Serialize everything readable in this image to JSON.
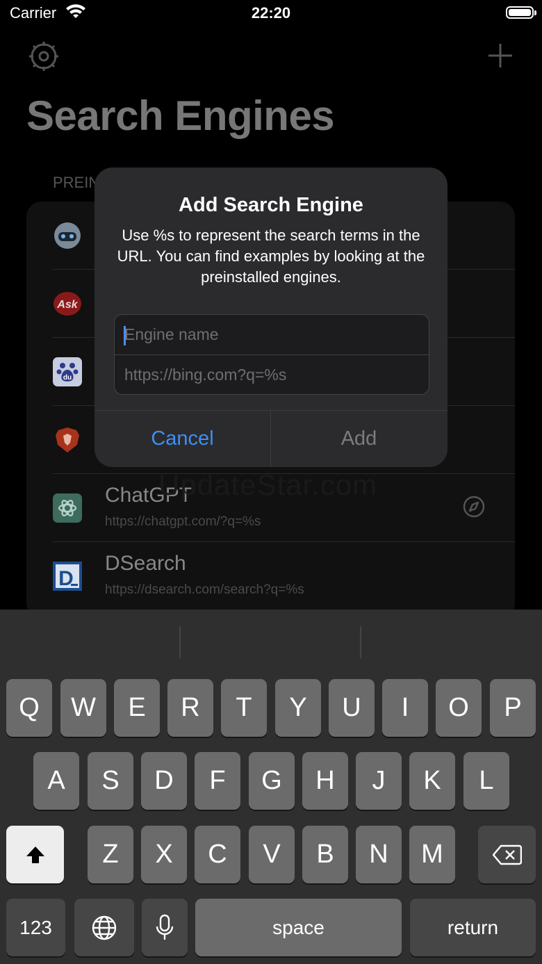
{
  "status": {
    "carrier": "Carrier",
    "time": "22:20"
  },
  "nav": {
    "settings_icon": "gear-icon",
    "add_icon": "plus-icon"
  },
  "page": {
    "title": "Search Engines",
    "section_header": "PREIN"
  },
  "engines": [
    {
      "name": "",
      "url": "",
      "icon": "robot-icon"
    },
    {
      "name": "",
      "url": "",
      "icon": "ask-logo"
    },
    {
      "name": "",
      "url": "",
      "icon": "baidu-logo"
    },
    {
      "name": "",
      "url": "",
      "icon": "brave-logo"
    },
    {
      "name": "ChatGPT",
      "url": "https://chatgpt.com/?q=%s",
      "icon": "chatgpt-logo"
    },
    {
      "name": "DSearch",
      "url": "https://dsearch.com/search?q=%s",
      "icon": "dsearch-logo"
    }
  ],
  "watermark": "UpdateStar.com",
  "dialog": {
    "title": "Add Search Engine",
    "message": "Use %s to represent the search terms in the URL. You can find examples by looking at the preinstalled engines.",
    "name_placeholder": "Engine name",
    "url_placeholder": "https://bing.com?q=%s",
    "cancel_label": "Cancel",
    "add_label": "Add"
  },
  "keyboard": {
    "row1": [
      "Q",
      "W",
      "E",
      "R",
      "T",
      "Y",
      "U",
      "I",
      "O",
      "P"
    ],
    "row2": [
      "A",
      "S",
      "D",
      "F",
      "G",
      "H",
      "J",
      "K",
      "L"
    ],
    "row3": [
      "Z",
      "X",
      "C",
      "V",
      "B",
      "N",
      "M"
    ],
    "numbers_label": "123",
    "space_label": "space",
    "return_label": "return"
  },
  "colors": {
    "accent": "#3d8ff5",
    "caret": "#4a8ef7",
    "dialog_bg": "#2b2b2d"
  }
}
